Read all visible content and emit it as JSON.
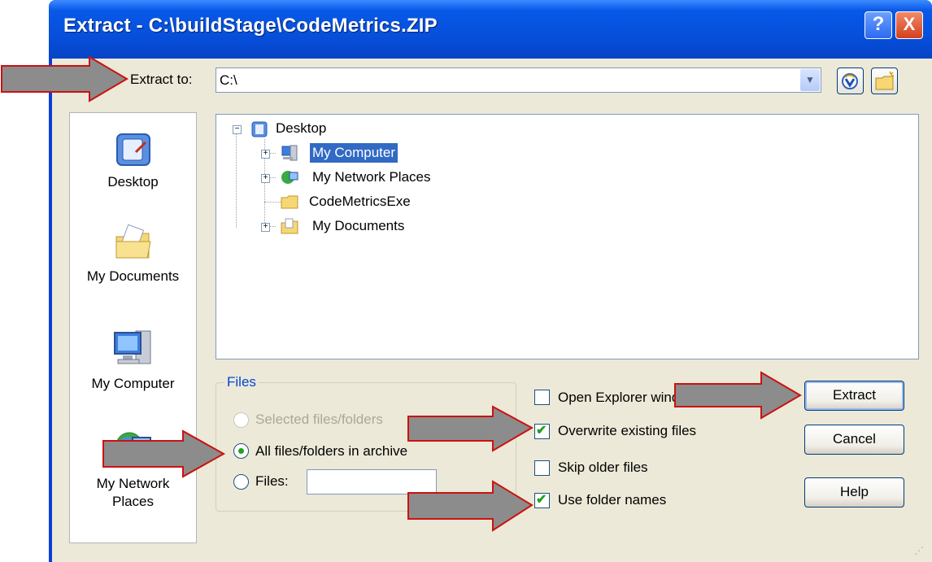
{
  "window": {
    "title": "Extract - C:\\buildStage\\CodeMetrics.ZIP",
    "help_glyph": "?",
    "close_glyph": "X"
  },
  "extract_to": {
    "label": "Extract to:",
    "value": "C:\\"
  },
  "places": [
    {
      "label": "Desktop",
      "icon": "desktop-icon"
    },
    {
      "label": "My Documents",
      "icon": "my-documents-icon"
    },
    {
      "label": "My Computer",
      "icon": "my-computer-icon"
    },
    {
      "label": "My Network Places",
      "icon": "network-places-icon"
    }
  ],
  "tree": {
    "root": "Desktop",
    "children": [
      "My Computer",
      "My Network Places",
      "CodeMetricsExe",
      "My Documents"
    ],
    "selected": "My Computer"
  },
  "files": {
    "legend": "Files",
    "option_selected": "Selected files/folders",
    "option_all": "All files/folders in archive",
    "option_files": "Files:",
    "files_value": ""
  },
  "options": {
    "open_explorer": {
      "label": "Open Explorer window",
      "checked": false
    },
    "overwrite": {
      "label": "Overwrite existing files",
      "checked": true
    },
    "skip_older": {
      "label": "Skip older files",
      "checked": false
    },
    "use_folder_names": {
      "label": "Use folder names",
      "checked": true
    }
  },
  "buttons": {
    "extract": "Extract",
    "cancel": "Cancel",
    "help": "Help"
  },
  "colors": {
    "titlebar": "#0650db",
    "dialog_bg": "#ece9d8",
    "selection": "#316ac5",
    "arrow_fill": "#8c8c8c",
    "arrow_outline": "#cc1111"
  }
}
